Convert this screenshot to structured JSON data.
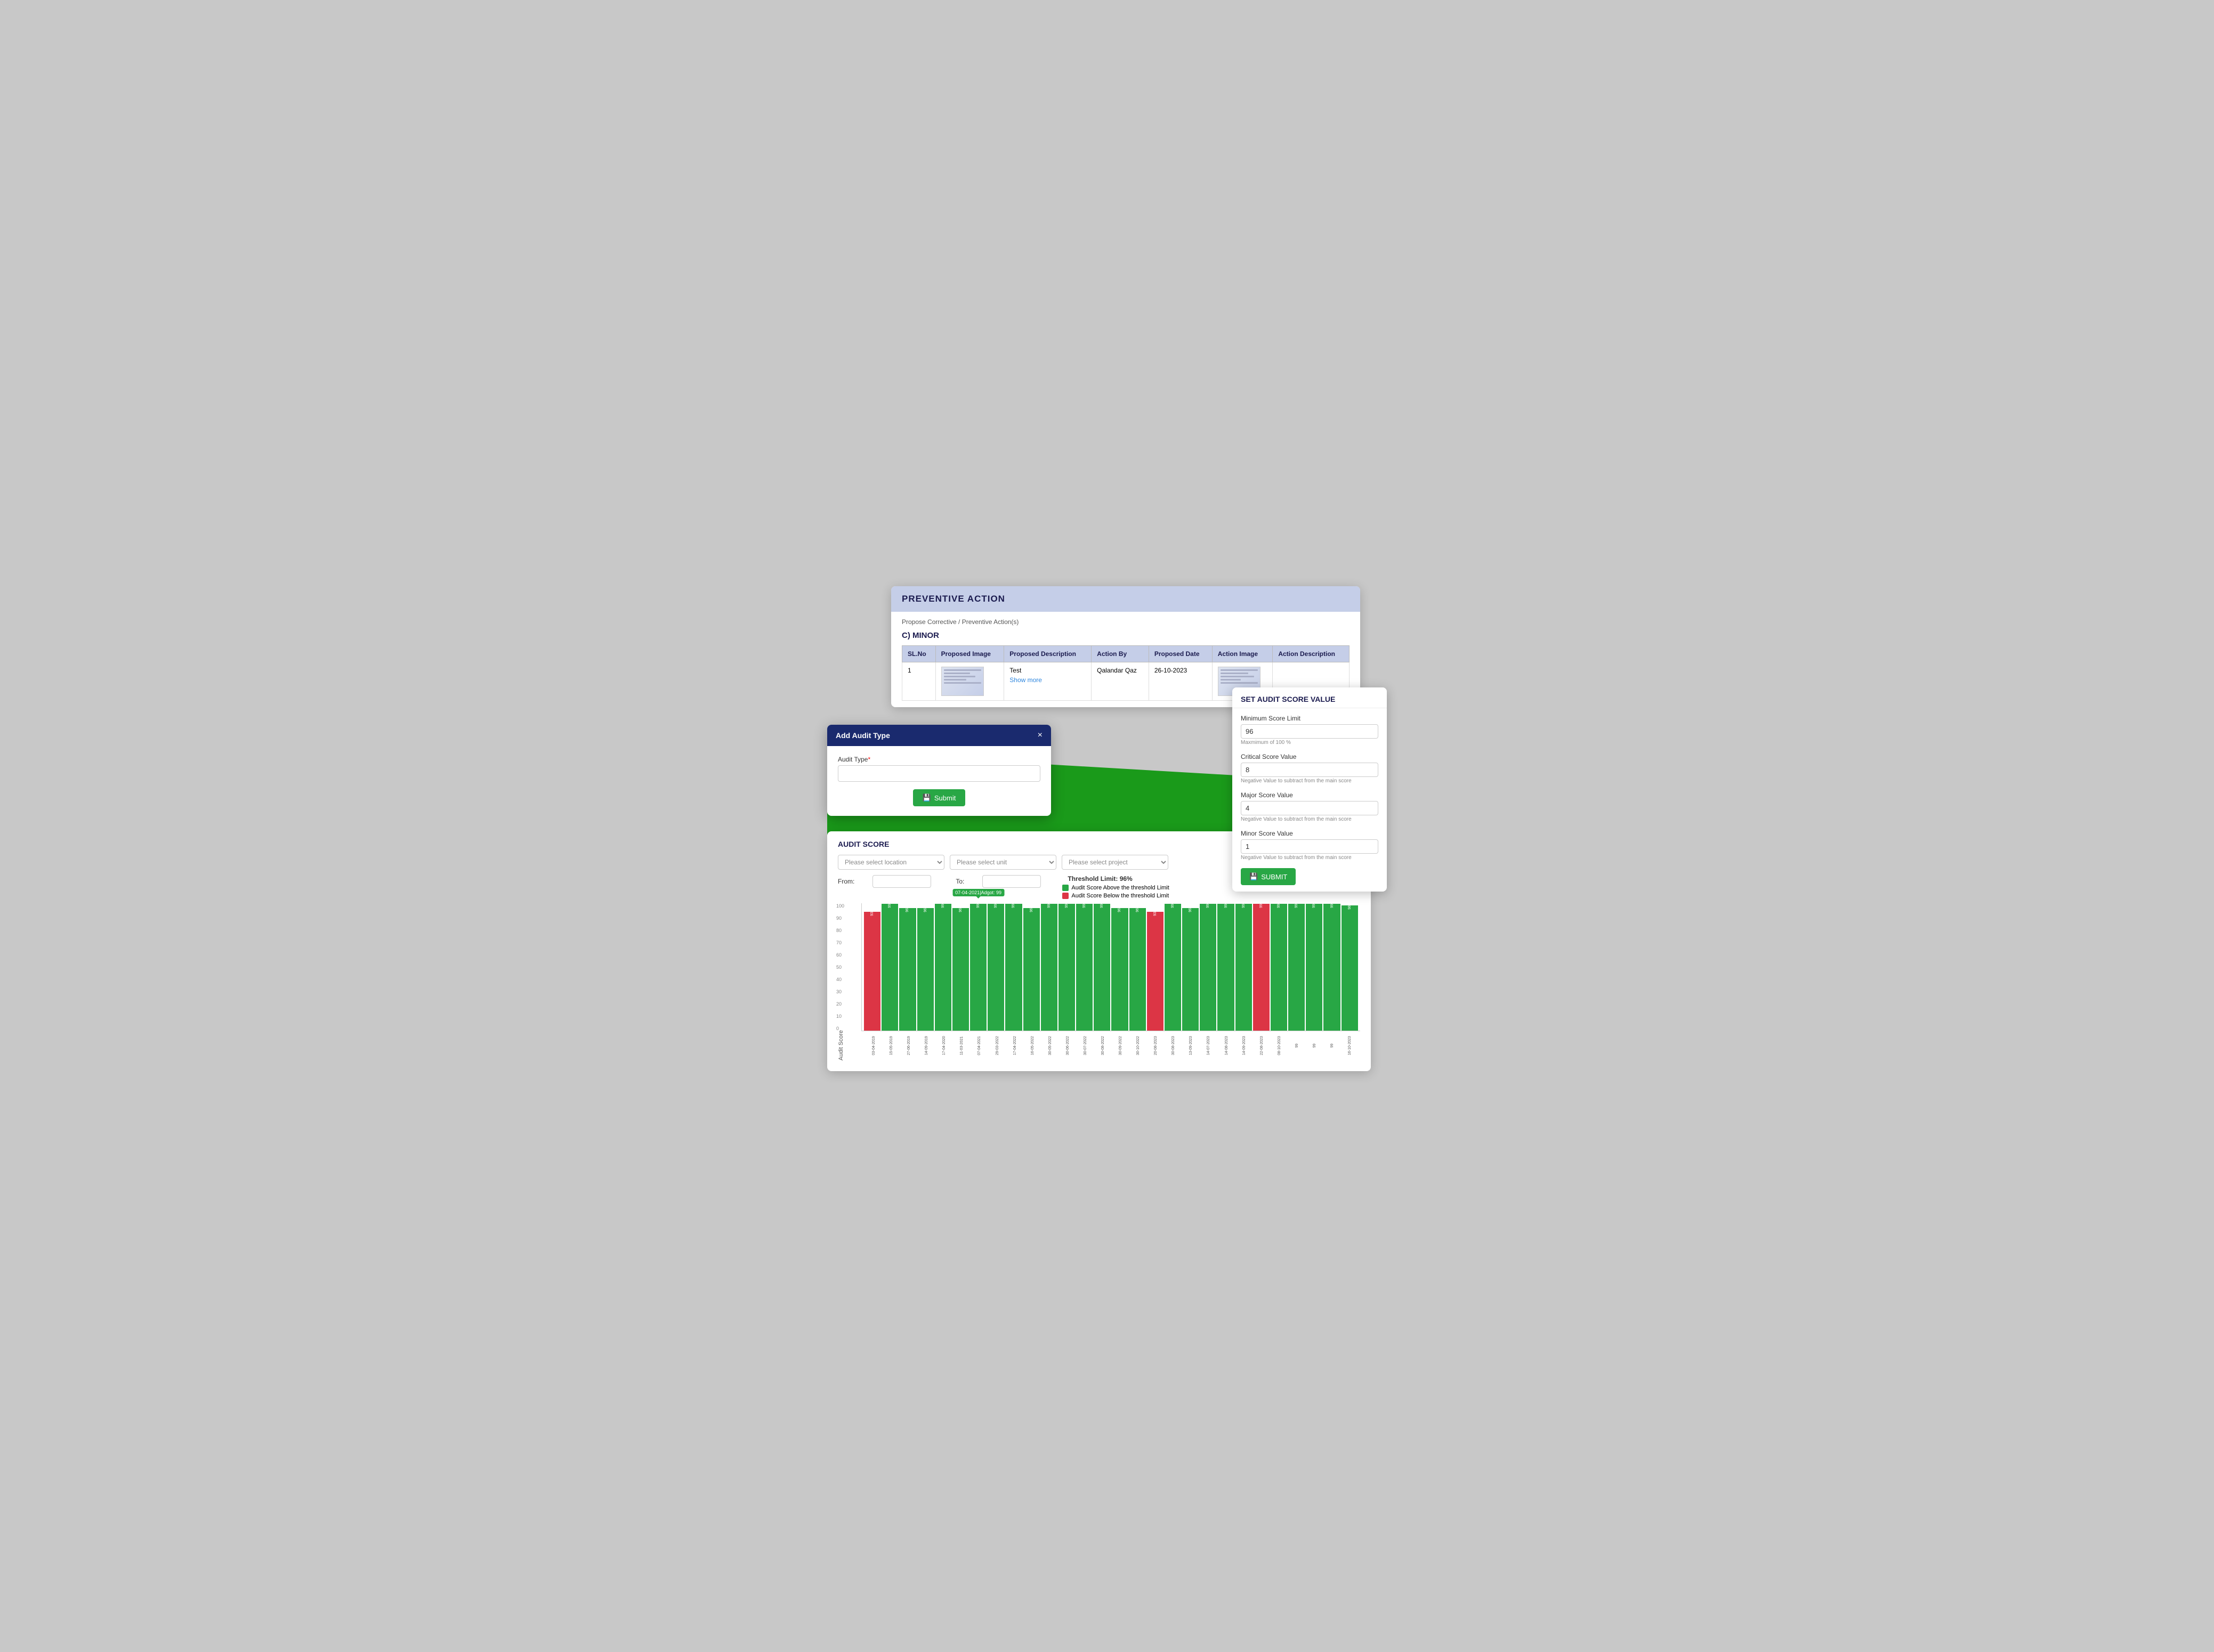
{
  "preventive": {
    "header": "PREVENTIVE ACTION",
    "breadcrumb": "Propose Corrective / Preventive Action(s)",
    "section": "C) MINOR",
    "table": {
      "headers": [
        "SL.No",
        "Proposed Image",
        "Proposed Description",
        "Action By",
        "Proposed Date",
        "Action Image",
        "Action Description"
      ],
      "rows": [
        {
          "sl": "1",
          "proposed_desc": "Test",
          "show_more": "Show more",
          "action_by": "Qalandar Qaz",
          "proposed_date": "26-10-2023"
        }
      ]
    }
  },
  "set_audit_score": {
    "title": "SET AUDIT SCORE VALUE",
    "fields": [
      {
        "label": "Minimum Score Limit",
        "value": "96",
        "hint": "Maxmimum of 100 %"
      },
      {
        "label": "Critical Score Value",
        "value": "8",
        "hint": "Negative Value to subtract from the main score"
      },
      {
        "label": "Major Score Value",
        "value": "4",
        "hint": "Negative Value to subtract from the main score"
      },
      {
        "label": "Minor Score Value",
        "value": "1",
        "hint": "Negative Value to subtract from the main score"
      }
    ],
    "submit_label": "SUBMIT"
  },
  "add_audit_modal": {
    "title": "Add Audit Type",
    "close_label": "×",
    "audit_type_label": "Audit Type",
    "audit_type_placeholder": "",
    "submit_label": "Submit"
  },
  "audit_score_section": {
    "title": "AUDIT SCORE",
    "location_placeholder": "Please select location",
    "unit_placeholder": "Please select unit",
    "project_placeholder": "Please select project",
    "from_label": "From:",
    "to_label": "To:",
    "threshold_label": "Threshold Limit: 96%",
    "legend": [
      {
        "label": "Audit Score Above the threshold Limit",
        "color": "#28a745"
      },
      {
        "label": "Audit Score Below the threshold Limit",
        "color": "#dc3545"
      }
    ],
    "y_axis_label": "Audit Score",
    "y_ticks": [
      "0",
      "10",
      "20",
      "30",
      "40",
      "50",
      "60",
      "70",
      "80",
      "90",
      "100"
    ],
    "tooltip": "07-04-2021|Adgot: 99",
    "bars": [
      {
        "value": 93,
        "label": "03-04-2019",
        "color": "red",
        "display": "93"
      },
      {
        "value": 99,
        "label": "15-05-2019",
        "color": "green",
        "display": "99"
      },
      {
        "value": 96,
        "label": "27-06-2019",
        "color": "green",
        "display": "96"
      },
      {
        "value": 96,
        "label": "14-09-2019",
        "color": "green",
        "display": "96"
      },
      {
        "value": 99,
        "label": "17-04-2020",
        "color": "green",
        "display": "99"
      },
      {
        "value": 96,
        "label": "11-03-2021",
        "color": "green",
        "display": "96"
      },
      {
        "value": 99,
        "label": "07-04-2021",
        "color": "green",
        "display": "99",
        "tooltip": true
      },
      {
        "value": 99,
        "label": "29-03-2022",
        "color": "green",
        "display": "99"
      },
      {
        "value": 99,
        "label": "17-04-2022",
        "color": "green",
        "display": "99"
      },
      {
        "value": 96,
        "label": "16-05-2022",
        "color": "green",
        "display": "96"
      },
      {
        "value": 99,
        "label": "30-05-2022",
        "color": "green",
        "display": "99"
      },
      {
        "value": 99,
        "label": "30-06-2022",
        "color": "green",
        "display": "99"
      },
      {
        "value": 99,
        "label": "30-07-2022",
        "color": "green",
        "display": "99"
      },
      {
        "value": 99,
        "label": "30-08-2022",
        "color": "green",
        "display": "99"
      },
      {
        "value": 96,
        "label": "30-09-2022",
        "color": "green",
        "display": "96"
      },
      {
        "value": 96,
        "label": "30-10-2022",
        "color": "green",
        "display": "96"
      },
      {
        "value": 93,
        "label": "20-08-2023",
        "color": "red",
        "display": "93"
      },
      {
        "value": 99,
        "label": "30-08-2023",
        "color": "green",
        "display": "99"
      },
      {
        "value": 96,
        "label": "13-09-2023",
        "color": "green",
        "display": "96"
      },
      {
        "value": 99,
        "label": "14-07-2023",
        "color": "green",
        "display": "99"
      },
      {
        "value": 99,
        "label": "14-08-2023",
        "color": "green",
        "display": "99"
      },
      {
        "value": 99,
        "label": "14-09-2023",
        "color": "green",
        "display": "99"
      },
      {
        "value": 99,
        "label": "22-08-2023",
        "color": "red",
        "display": "99"
      },
      {
        "value": 99,
        "label": "08-10-2023",
        "color": "green",
        "display": "99"
      },
      {
        "value": 99,
        "label": "99",
        "color": "green",
        "display": "99"
      },
      {
        "value": 99,
        "label": "99",
        "color": "green",
        "display": "99"
      },
      {
        "value": 99,
        "label": "99",
        "color": "green",
        "display": "99"
      },
      {
        "value": 98,
        "label": "16-10-2023",
        "color": "green",
        "display": "98"
      }
    ]
  }
}
